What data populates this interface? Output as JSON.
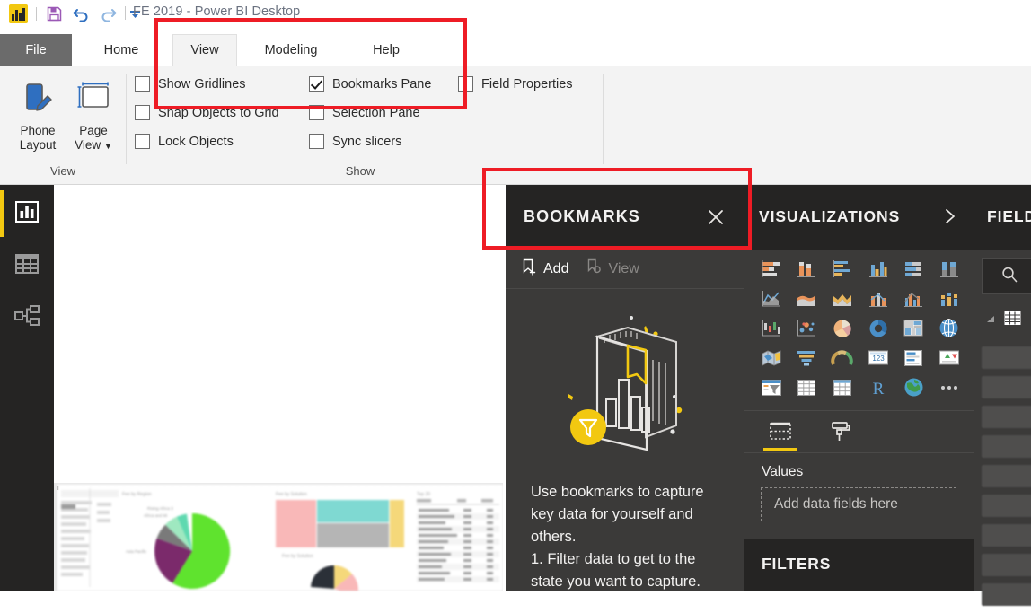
{
  "window": {
    "title": "FE 2019 - Power BI Desktop",
    "quick_access": [
      {
        "name": "power-bi-logo",
        "label": "Power BI"
      },
      {
        "name": "save-icon",
        "label": "Save"
      },
      {
        "name": "undo-icon",
        "label": "Undo"
      },
      {
        "name": "redo-icon",
        "label": "Redo"
      },
      {
        "name": "customize-quick-access-toolbar-icon",
        "label": "Customize Quick Access Toolbar"
      }
    ]
  },
  "ribbon": {
    "tabs": [
      {
        "label": "File",
        "active": false
      },
      {
        "label": "Home",
        "active": false
      },
      {
        "label": "View",
        "active": true
      },
      {
        "label": "Modeling",
        "active": false
      },
      {
        "label": "Help",
        "active": false
      }
    ],
    "groups": [
      {
        "label": "View"
      },
      {
        "label": "Show"
      }
    ],
    "buttons": [
      {
        "label_line1": "Phone",
        "label_line2": "Layout",
        "icon": "phone-layout-icon"
      },
      {
        "label_line1": "Page",
        "label_line2": "View",
        "icon": "page-view-icon",
        "dropdown": true
      }
    ],
    "checkboxes": [
      {
        "label": "Show Gridlines",
        "checked": false
      },
      {
        "label": "Snap Objects to Grid",
        "checked": false
      },
      {
        "label": "Lock Objects",
        "checked": false
      },
      {
        "label": "Bookmarks Pane",
        "checked": true
      },
      {
        "label": "Selection Pane",
        "checked": false
      },
      {
        "label": "Sync slicers",
        "checked": false
      },
      {
        "label": "Field Properties",
        "checked": false
      }
    ]
  },
  "left_rail": {
    "items": [
      {
        "name": "report-view",
        "label": "Report",
        "selected": true
      },
      {
        "name": "data-view",
        "label": "Data",
        "selected": false
      },
      {
        "name": "model-view",
        "label": "Model",
        "selected": false
      }
    ]
  },
  "bookmarks_pane": {
    "title": "BOOKMARKS",
    "close_label": "Close",
    "tools": [
      {
        "label": "Add",
        "icon": "add-bookmark-icon",
        "enabled": true
      },
      {
        "label": "View",
        "icon": "view-bookmark-icon",
        "enabled": false
      }
    ],
    "empty_art": "bookmarks-illustration",
    "empty_text": "Use bookmarks to capture key data for yourself and others.\n1. Filter data to get to the state you want to capture."
  },
  "visualizations_pane": {
    "title": "VISUALIZATIONS",
    "expand_label": "Expand",
    "icons": [
      "stacked-bar-chart-icon",
      "stacked-column-chart-icon",
      "clustered-bar-chart-icon",
      "clustered-column-chart-icon",
      "hundred-percent-stacked-bar-chart-icon",
      "hundred-percent-stacked-column-chart-icon",
      "line-chart-icon",
      "area-chart-icon",
      "stacked-area-chart-icon",
      "line-and-stacked-column-chart-icon",
      "line-and-clustered-column-chart-icon",
      "ribbon-chart-icon",
      "waterfall-chart-icon",
      "scatter-chart-icon",
      "pie-chart-icon",
      "donut-chart-icon",
      "treemap-icon",
      "map-icon",
      "filled-map-icon",
      "funnel-chart-icon",
      "gauge-chart-icon",
      "card-icon",
      "multi-row-card-icon",
      "kpi-icon",
      "slicer-icon",
      "table-icon",
      "matrix-icon",
      "r-script-visual-icon",
      "arcgis-map-icon",
      "more-options-icon"
    ],
    "format_tabs": [
      {
        "name": "fields-tab",
        "selected": true
      },
      {
        "name": "format-tab",
        "selected": false
      }
    ],
    "field_well": {
      "label": "Values",
      "placeholder": "Add data fields here"
    }
  },
  "filters_pane": {
    "title": "FILTERS"
  },
  "fields_pane": {
    "title": "FIELDS",
    "search_icon": "search-icon",
    "table_icon": "table-icon",
    "field_row_count": 9
  },
  "annotations": [
    {
      "name": "ribbon-highlight",
      "color": "#ee1c25"
    },
    {
      "name": "bookmarks-header-highlight",
      "color": "#ee1c25"
    }
  ],
  "canvas": {
    "report_preview": "blurred-report-page-thumbnail"
  },
  "colors": {
    "accent_yellow": "#f2c811",
    "pane_dark": "#3b3a39",
    "pane_header_dark": "#252423",
    "ribbon_bg": "#f3f3f3",
    "annotation_red": "#ee1c25"
  }
}
